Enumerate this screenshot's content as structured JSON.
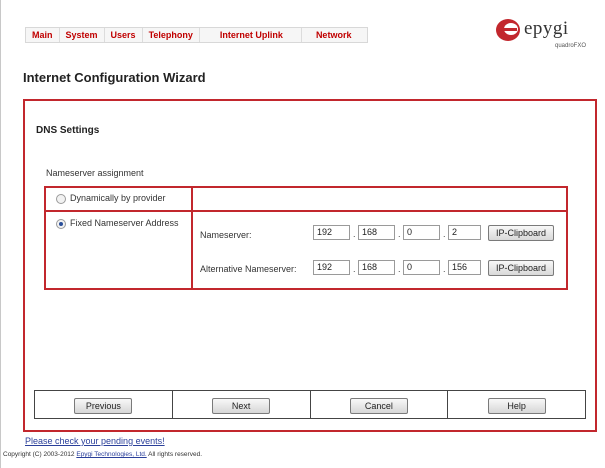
{
  "nav": {
    "items": [
      "Main",
      "System",
      "Users",
      "Telephony",
      "Internet Uplink",
      "Network"
    ]
  },
  "logo": {
    "word": "epygi",
    "sub": "quadroFXO",
    "color": "#c2272d"
  },
  "page": {
    "title": "Internet Configuration Wizard"
  },
  "section": {
    "title": "DNS Settings",
    "assignment_label": "Nameserver assignment"
  },
  "options": {
    "dynamic_label": "Dynamically by provider",
    "fixed_label": "Fixed Nameserver Address",
    "selected": "fixed"
  },
  "nameserver": {
    "label": "Nameserver:",
    "octets": [
      "192",
      "168",
      "0",
      "2"
    ],
    "clipboard": "IP-Clipboard"
  },
  "alt_nameserver": {
    "label": "Alternative Nameserver:",
    "octets": [
      "192",
      "168",
      "0",
      "156"
    ],
    "clipboard": "IP-Clipboard"
  },
  "buttons": {
    "previous": "Previous",
    "next": "Next",
    "cancel": "Cancel",
    "help": "Help"
  },
  "footer": {
    "events_link": "Please check your pending events!",
    "copyright_prefix": "Copyright (C) 2003-2012",
    "copyright_company": "Epygi Technologies, Ltd.",
    "copyright_suffix": "All rights reserved."
  },
  "colors": {
    "accent": "#c2272d",
    "nav_text": "#c00000",
    "link": "#2a3f9a"
  }
}
